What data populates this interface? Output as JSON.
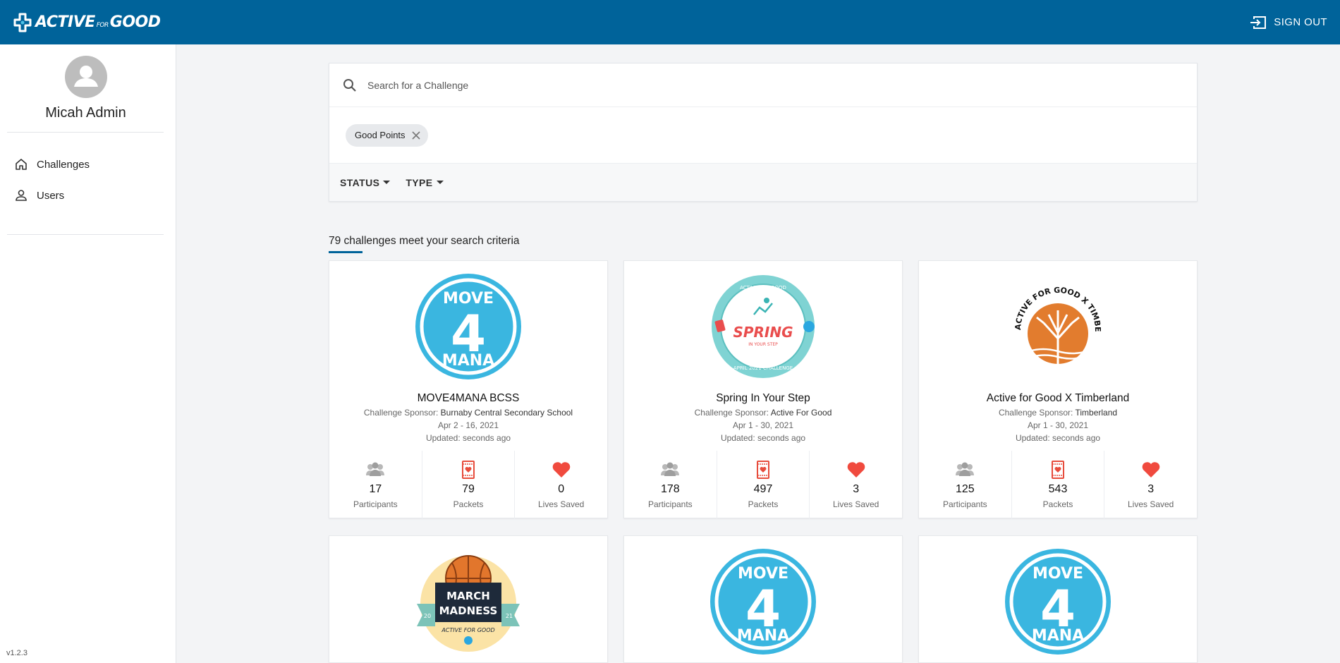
{
  "header": {
    "logo_main": "ACTIVE",
    "logo_for": "FOR",
    "logo_good": "GOOD",
    "signout_label": "SIGN OUT",
    "brand_color": "#00639a"
  },
  "sidebar": {
    "user_name": "Micah Admin",
    "items": [
      {
        "label": "Challenges",
        "icon": "home-icon"
      },
      {
        "label": "Users",
        "icon": "person-icon"
      }
    ],
    "version": "v1.2.3"
  },
  "search": {
    "placeholder": "Search for a Challenge",
    "chip_label": "Good Points",
    "filters": [
      {
        "label": "STATUS"
      },
      {
        "label": "TYPE"
      }
    ]
  },
  "results": {
    "summary": "79 challenges meet your search criteria"
  },
  "cards": [
    {
      "logo": "move4mana-logo",
      "logo_text": [
        "MOVE",
        "4",
        "MANA"
      ],
      "title": "MOVE4MANA BCSS",
      "sponsor_label": "Challenge Sponsor:",
      "sponsor": "Burnaby Central Secondary School",
      "dates": "Apr 2 - 16, 2021",
      "updated": "Updated: seconds ago",
      "participants": "17",
      "packets": "79",
      "lives": "0",
      "participants_label": "Participants",
      "packets_label": "Packets",
      "lives_label": "Lives Saved"
    },
    {
      "logo": "spring-logo",
      "logo_text": [
        "ACTIVE FOR GOOD",
        "SPRING",
        "IN YOUR STEP",
        "APRIL 2021 CHALLENGE"
      ],
      "title": "Spring In Your Step",
      "sponsor_label": "Challenge Sponsor:",
      "sponsor": "Active For Good",
      "dates": "Apr 1 - 30, 2021",
      "updated": "Updated: seconds ago",
      "participants": "178",
      "packets": "497",
      "lives": "3",
      "participants_label": "Participants",
      "packets_label": "Packets",
      "lives_label": "Lives Saved"
    },
    {
      "logo": "timberland-logo",
      "logo_text": [
        "ACTIVE FOR GOOD X TIMBERLAND"
      ],
      "title": "Active for Good X Timberland",
      "sponsor_label": "Challenge Sponsor:",
      "sponsor": "Timberland",
      "dates": "Apr 1 - 30, 2021",
      "updated": "Updated: seconds ago",
      "participants": "125",
      "packets": "543",
      "lives": "3",
      "participants_label": "Participants",
      "packets_label": "Packets",
      "lives_label": "Lives Saved"
    },
    {
      "logo": "march-madness-logo",
      "logo_text": [
        "MARCH",
        "MADNESS",
        "20",
        "21",
        "ACTIVE FOR GOOD"
      ]
    },
    {
      "logo": "move4mana-logo",
      "logo_text": [
        "MOVE",
        "4",
        "MANA"
      ]
    },
    {
      "logo": "move4mana-logo",
      "logo_text": [
        "MOVE",
        "4",
        "MANA"
      ]
    }
  ]
}
